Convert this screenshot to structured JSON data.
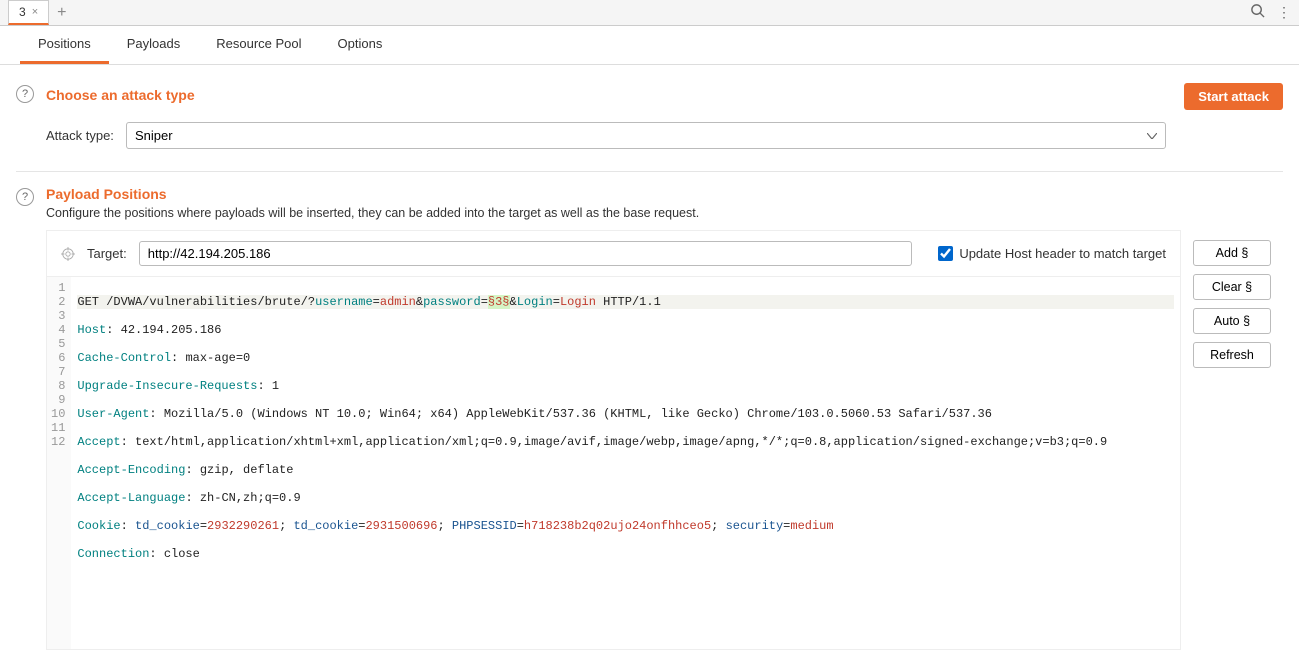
{
  "top": {
    "tab_label": "3",
    "add_glyph": "+",
    "search_glyph": "⌕",
    "menu_glyph": "⋮"
  },
  "subtabs": [
    "Positions",
    "Payloads",
    "Resource Pool",
    "Options"
  ],
  "active_subtab": 0,
  "attack_section": {
    "title": "Choose an attack type",
    "label": "Attack type:",
    "selected": "Sniper",
    "start_button": "Start attack"
  },
  "positions_section": {
    "title": "Payload Positions",
    "desc": "Configure the positions where payloads will be inserted, they can be added into the target as well as the base request.",
    "target_label": "Target:",
    "target_value": "http://42.194.205.186",
    "update_host_label": "Update Host header to match target",
    "update_host_checked": true
  },
  "side_buttons": {
    "add": "Add §",
    "clear": "Clear §",
    "auto": "Auto §",
    "refresh": "Refresh"
  },
  "request": {
    "line1": {
      "method": "GET",
      "path_pre": " /DVWA/vulnerabilities/brute/?",
      "p_user_k": "username",
      "eq": "=",
      "p_user_v": "admin",
      "amp1": "&",
      "p_pass_k": "password",
      "p_pass_v_marker": "§3§",
      "amp2": "&",
      "p_login_k": "Login",
      "p_login_v": "Login",
      "proto": " HTTP/1.1"
    },
    "line2": {
      "k": "Host",
      "sep": ": ",
      "v": "42.194.205.186"
    },
    "line3": {
      "k": "Cache-Control",
      "sep": ": ",
      "v": "max-age=0"
    },
    "line4": {
      "k": "Upgrade-Insecure-Requests",
      "sep": ": ",
      "v": "1"
    },
    "line5": {
      "k": "User-Agent",
      "sep": ": ",
      "v": "Mozilla/5.0 (Windows NT 10.0; Win64; x64) AppleWebKit/537.36 (KHTML, like Gecko) Chrome/103.0.5060.53 Safari/537.36"
    },
    "line6": {
      "k": "Accept",
      "sep": ": ",
      "v": "text/html,application/xhtml+xml,application/xml;q=0.9,image/avif,image/webp,image/apng,*/*;q=0.8,application/signed-exchange;v=b3;q=0.9"
    },
    "line7": {
      "k": "Accept-Encoding",
      "sep": ": ",
      "v": "gzip, deflate"
    },
    "line8": {
      "k": "Accept-Language",
      "sep": ": ",
      "v": "zh-CN,zh;q=0.9"
    },
    "line9": {
      "k": "Cookie",
      "sep": ": ",
      "c1k": "td_cookie",
      "c1v": "2932290261",
      "d1": "; ",
      "c2k": "td_cookie",
      "c2v": "2931500696",
      "d2": "; ",
      "c3k": "PHPSESSID",
      "c3v": "h718238b2q02ujo24onfhhceo5",
      "d3": "; ",
      "c4k": "security",
      "c4v": "medium"
    },
    "line10": {
      "k": "Connection",
      "sep": ": ",
      "v": "close"
    },
    "gutter": [
      "1",
      "2",
      "3",
      "4",
      "5",
      "6",
      "7",
      "8",
      "9",
      "10",
      "11",
      "12"
    ]
  }
}
